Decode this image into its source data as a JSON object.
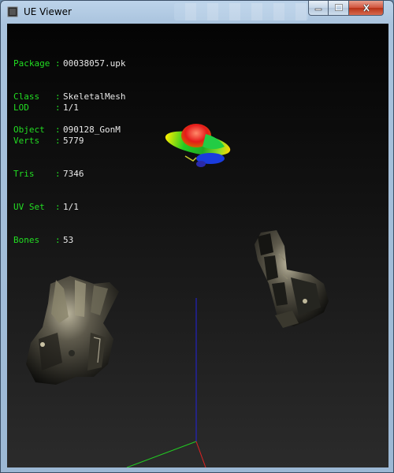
{
  "window": {
    "title": "UE Viewer"
  },
  "controls": {
    "minimize": "minimize",
    "maximize": "maximize",
    "close": "close"
  },
  "info": [
    {
      "key": "Package :",
      "value": "00038057.upk"
    },
    {
      "key": "Class   :",
      "value": "SkeletalMesh"
    },
    {
      "key": "Object  :",
      "value": "090128_GonM"
    }
  ],
  "stats": [
    {
      "key": "LOD     :",
      "value": "1/1"
    },
    {
      "key": "Verts   :",
      "value": "5779"
    },
    {
      "key": "Tris    :",
      "value": "7346"
    },
    {
      "key": "UV Set  :",
      "value": "1/1"
    },
    {
      "key": "Bones   :",
      "value": "53"
    }
  ],
  "colors": {
    "hud_key": "#22dd22",
    "hud_value": "#e8e8e8",
    "axis_x": "#dd2222",
    "axis_y": "#22cc22",
    "axis_z": "#2222dd"
  }
}
